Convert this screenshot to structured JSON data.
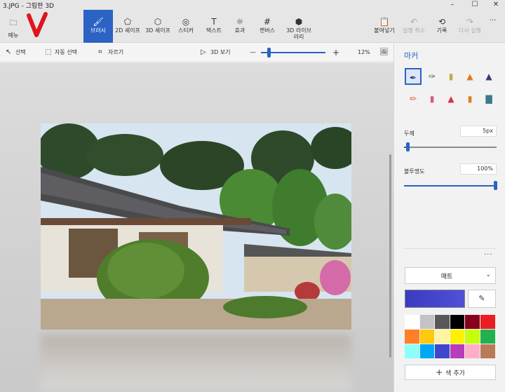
{
  "window": {
    "title": "3.JPG - 그림판 3D",
    "minimize_glyph": "–",
    "maximize_glyph": "☐",
    "close_glyph": "✕"
  },
  "ribbon": {
    "menu": {
      "icon": "folder-icon",
      "label": "메뉴"
    },
    "tools": [
      {
        "name": "brushes",
        "label": "브러시",
        "icon": "brush-icon",
        "glyph": "🖌",
        "active": true
      },
      {
        "name": "2d-shapes",
        "label": "2D 셰이프",
        "icon": "2d-shapes-icon",
        "glyph": "⬠",
        "active": false
      },
      {
        "name": "3d-shapes",
        "label": "3D 셰이프",
        "icon": "3d-cube-icon",
        "glyph": "⬡",
        "active": false
      },
      {
        "name": "stickers",
        "label": "스티커",
        "icon": "sticker-icon",
        "glyph": "◎",
        "active": false
      },
      {
        "name": "text",
        "label": "텍스트",
        "icon": "text-icon",
        "glyph": "T",
        "active": false
      },
      {
        "name": "effects",
        "label": "효과",
        "icon": "effects-sun-icon",
        "glyph": "☼",
        "active": false
      },
      {
        "name": "canvas",
        "label": "캔버스",
        "icon": "canvas-crop-icon",
        "glyph": "#",
        "active": false
      },
      {
        "name": "3d-library",
        "label": "3D 라이브\n러리",
        "icon": "3d-library-icon",
        "glyph": "⬢",
        "active": false
      }
    ],
    "right_tools": [
      {
        "name": "paste",
        "label": "붙여넣기",
        "icon": "paste-icon",
        "glyph": "📋",
        "disabled": false
      },
      {
        "name": "undo",
        "label": "실행 취소",
        "icon": "undo-icon",
        "glyph": "↶",
        "disabled": true
      },
      {
        "name": "history",
        "label": "기록",
        "icon": "history-icon",
        "glyph": "⟲",
        "disabled": false
      },
      {
        "name": "redo",
        "label": "다시 실행",
        "icon": "redo-icon",
        "glyph": "↷",
        "disabled": true
      }
    ],
    "more_glyph": "···"
  },
  "toolbar": {
    "select_label": "선택",
    "magic_select_label": "자동 선택",
    "crop_label": "자르기",
    "view3d_label": "3D 보기",
    "zoom_minus": "—",
    "zoom_plus": "+",
    "zoom_level": "12%",
    "zoom_fraction": 0.1
  },
  "panel": {
    "title": "마커",
    "brushes": [
      {
        "icon": "marker-icon",
        "glyph": "✒",
        "color": "#2b3a8a",
        "selected": true
      },
      {
        "icon": "calligraphy-pen-icon",
        "glyph": "✑",
        "color": "#2b6a3a",
        "selected": false
      },
      {
        "icon": "oil-brush-icon",
        "glyph": "▮",
        "color": "#c9a64a",
        "selected": false
      },
      {
        "icon": "watercolor-icon",
        "glyph": "▲",
        "color": "#e07a1a",
        "selected": false
      },
      {
        "icon": "pixel-pen-icon",
        "glyph": "▲",
        "color": "#3a3a7a",
        "selected": false
      },
      {
        "icon": "pencil-icon",
        "glyph": "✏",
        "color": "#d9611e",
        "selected": false
      },
      {
        "icon": "eraser-icon",
        "glyph": "▮",
        "color": "#d15a8a",
        "selected": false
      },
      {
        "icon": "crayon-icon",
        "glyph": "▲",
        "color": "#d8324f",
        "selected": false
      },
      {
        "icon": "spray-can-icon",
        "glyph": "▮",
        "color": "#e07a1a",
        "selected": false
      },
      {
        "icon": "fill-bucket-icon",
        "glyph": "▇",
        "color": "#3a7a8a",
        "selected": false
      }
    ],
    "thickness_label": "두께",
    "thickness_value": "5px",
    "thickness_fraction": 0.04,
    "opacity_label": "불투명도",
    "opacity_value": "100%",
    "opacity_fraction": 1.0,
    "finish_value": "매트",
    "current_color": "#3b3bc0",
    "palette": [
      "#ffffff",
      "#c3c3c3",
      "#585858",
      "#000000",
      "#88001b",
      "#ec1c24",
      "#ff7f27",
      "#ffc90e",
      "#fff4a3",
      "#fff200",
      "#c4ff0e",
      "#22b14c",
      "#8cfffb",
      "#00a8f3",
      "#3f48cc",
      "#b83dba",
      "#ffaec8",
      "#b97a57"
    ],
    "add_color_label": "색 추가"
  }
}
